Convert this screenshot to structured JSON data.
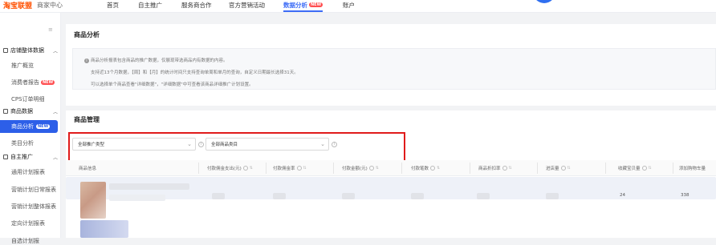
{
  "app": {
    "logo_mark": "淘宝联盟",
    "logo_sub": "商家中心"
  },
  "topnav": {
    "items": [
      {
        "label": "首页"
      },
      {
        "label": "自主推广"
      },
      {
        "label": "服务商合作"
      },
      {
        "label": "官方营销活动"
      },
      {
        "label": "数据分析",
        "badge": "NEW",
        "active": true
      },
      {
        "label": "账户"
      }
    ]
  },
  "sidebar": {
    "groups": [
      {
        "label": "店铺整体数据",
        "items": [
          "推广概览",
          "消费者报告",
          "CPS订单明细"
        ],
        "badges": [
          "",
          "NEW",
          ""
        ]
      },
      {
        "label": "商品数据",
        "items": [
          "商品分析",
          "类目分析"
        ],
        "active_item": "商品分析",
        "active_badge": "NEW"
      },
      {
        "label": "自主推广",
        "items": [
          "通用计划报表",
          "营销计划日常报表",
          "营销计划整体报表",
          "定向计划报表",
          "自选计划报"
        ]
      }
    ]
  },
  "analysis_panel": {
    "title": "商品分析",
    "notice_lines": [
      "商品分析报表包含商品的推广数据，仅展现带选商品内有数据的内容。",
      "支持近13个月数据，【周】和【月】的统计时间只支持查询单周和单月的查询，自定义日期最长选择31天。",
      "可以选择单个商品查看\"详细数据\"，\"详细数据\"中可查看该商品详细推广计划设置。"
    ]
  },
  "management_panel": {
    "title": "商品管理",
    "filter_promo_type": "全部推广类型",
    "filter_category": "全部商品类目"
  },
  "table": {
    "columns": [
      {
        "label": "商品信息"
      },
      {
        "label": "付款佣金支出(元)"
      },
      {
        "label": "付款佣金率"
      },
      {
        "label": "付款金额(元)"
      },
      {
        "label": "付款笔数"
      },
      {
        "label": "商品折扣率"
      },
      {
        "label": "进店量"
      },
      {
        "label": "收藏宝贝量"
      },
      {
        "label": "添加购物车量"
      }
    ],
    "row_values": {
      "collect": "24",
      "cart": "338"
    }
  },
  "colors": {
    "accent": "#3d6cf6",
    "sidebar_active": "#2d5fe8",
    "highlight_box": "#e01b1b",
    "badge": "#ff4d4f"
  }
}
